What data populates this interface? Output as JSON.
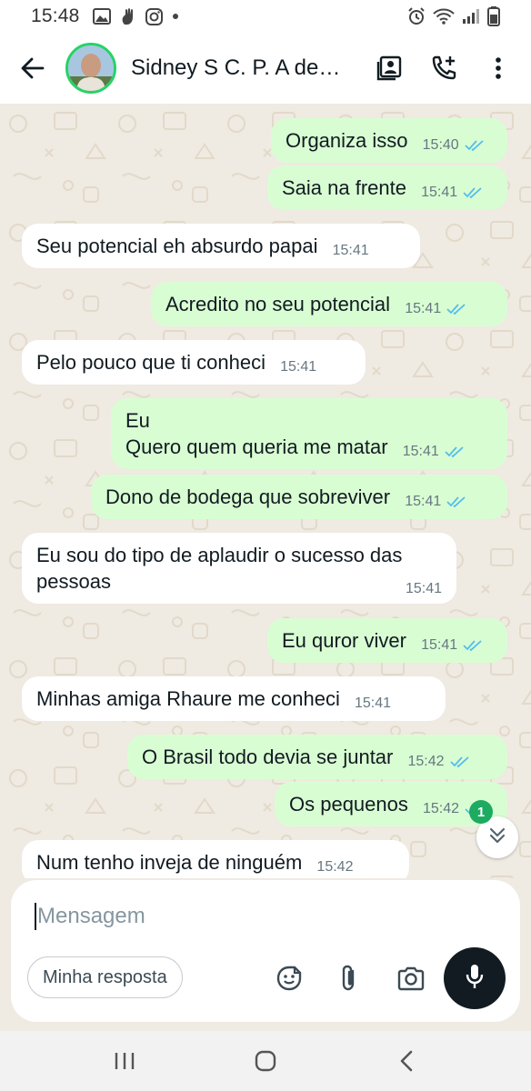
{
  "status_bar": {
    "time": "15:48",
    "left_icons": [
      "gallery-icon",
      "hand-gesture-icon",
      "instagram-icon",
      "dot-icon"
    ],
    "right_icons": [
      "alarm-icon",
      "wifi-icon",
      "signal-icon",
      "battery-icon"
    ]
  },
  "header": {
    "contact_name": "Sidney S C. P. A de…",
    "icons": [
      "back-arrow-icon",
      "contact-card-icon",
      "add-call-icon",
      "more-vert-icon"
    ]
  },
  "colors": {
    "outgoing_bubble": "#d9fdd3",
    "incoming_bubble": "#ffffff",
    "read_ticks": "#53bdeb",
    "accent_green": "#25d366",
    "chat_background": "#efeae2"
  },
  "messages": [
    {
      "dir": "out",
      "text": "Organiza isso",
      "time": "15:40",
      "status": "read"
    },
    {
      "dir": "out",
      "text": "Saia na frente",
      "time": "15:41",
      "status": "read"
    },
    {
      "dir": "in",
      "text": "Seu potencial eh absurdo papai",
      "time": "15:41"
    },
    {
      "dir": "out",
      "text": "Acredito no seu potencial",
      "time": "15:41",
      "status": "read"
    },
    {
      "dir": "in",
      "text": "Pelo pouco que ti conheci",
      "time": "15:41"
    },
    {
      "dir": "out",
      "line1": "Eu",
      "line2": "Quero quem queria me matar",
      "time": "15:41",
      "status": "read"
    },
    {
      "dir": "out",
      "text": "Dono de bodega que sobreviver",
      "time": "15:41",
      "status": "read"
    },
    {
      "dir": "in",
      "line1": "Eu sou do tipo de aplaudir o sucesso das",
      "line2": "pessoas",
      "time": "15:41"
    },
    {
      "dir": "out",
      "text": "Eu quror viver",
      "time": "15:41",
      "status": "read"
    },
    {
      "dir": "in",
      "text": "Minhas amiga Rhaure me conheci",
      "time": "15:41"
    },
    {
      "dir": "out",
      "text": "O Brasil todo devia se juntar",
      "time": "15:42",
      "status": "read"
    },
    {
      "dir": "out",
      "text": "Os pequenos",
      "time": "15:42",
      "status": "read"
    },
    {
      "dir": "in",
      "text": "Num tenho inveja de ninguém",
      "time": "15:42"
    }
  ],
  "unread_count": "1",
  "composer": {
    "placeholder": "Mensagem",
    "quick_reply": "Minha resposta",
    "icons": [
      "sticker-icon",
      "attach-icon",
      "camera-icon",
      "mic-icon"
    ]
  },
  "nav_bar": {
    "icons": [
      "recents-icon",
      "home-icon",
      "back-nav-icon"
    ]
  }
}
